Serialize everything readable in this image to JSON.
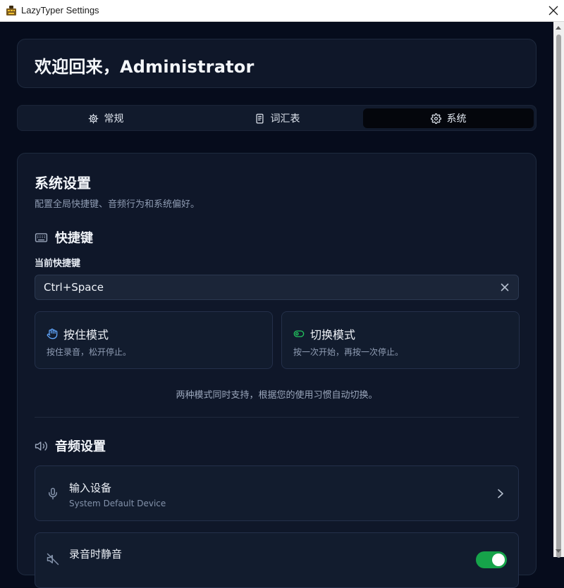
{
  "window": {
    "title": "LazyTyper Settings"
  },
  "welcome": {
    "heading": "欢迎回来，Administrator"
  },
  "tabs": [
    {
      "label": "常规",
      "icon": "gear-icon"
    },
    {
      "label": "词汇表",
      "icon": "document-icon"
    },
    {
      "label": "系统",
      "icon": "gear-icon",
      "active": true
    }
  ],
  "system": {
    "title": "系统设置",
    "description": "配置全局快捷键、音频行为和系统偏好。",
    "hotkey": {
      "section_title": "快捷键",
      "field_label": "当前快捷键",
      "value": "Ctrl+Space",
      "modes": [
        {
          "title": "按住模式",
          "description": "按住录音，松开停止。",
          "icon": "hand-icon",
          "icon_color": "#60a5fa"
        },
        {
          "title": "切换模式",
          "description": "按一次开始，再按一次停止。",
          "icon": "toggle-icon",
          "icon_color": "#22c55e"
        }
      ],
      "note": "两种模式同时支持，根据您的使用习惯自动切换。"
    },
    "audio": {
      "section_title": "音频设置",
      "input_device": {
        "title": "输入设备",
        "subtitle": "System Default Device"
      },
      "mute_while_recording": {
        "title": "录音时静音",
        "enabled": true
      }
    }
  },
  "colors": {
    "accent_green": "#16a34a",
    "background": "#060c1c",
    "card": "#0f1729"
  }
}
